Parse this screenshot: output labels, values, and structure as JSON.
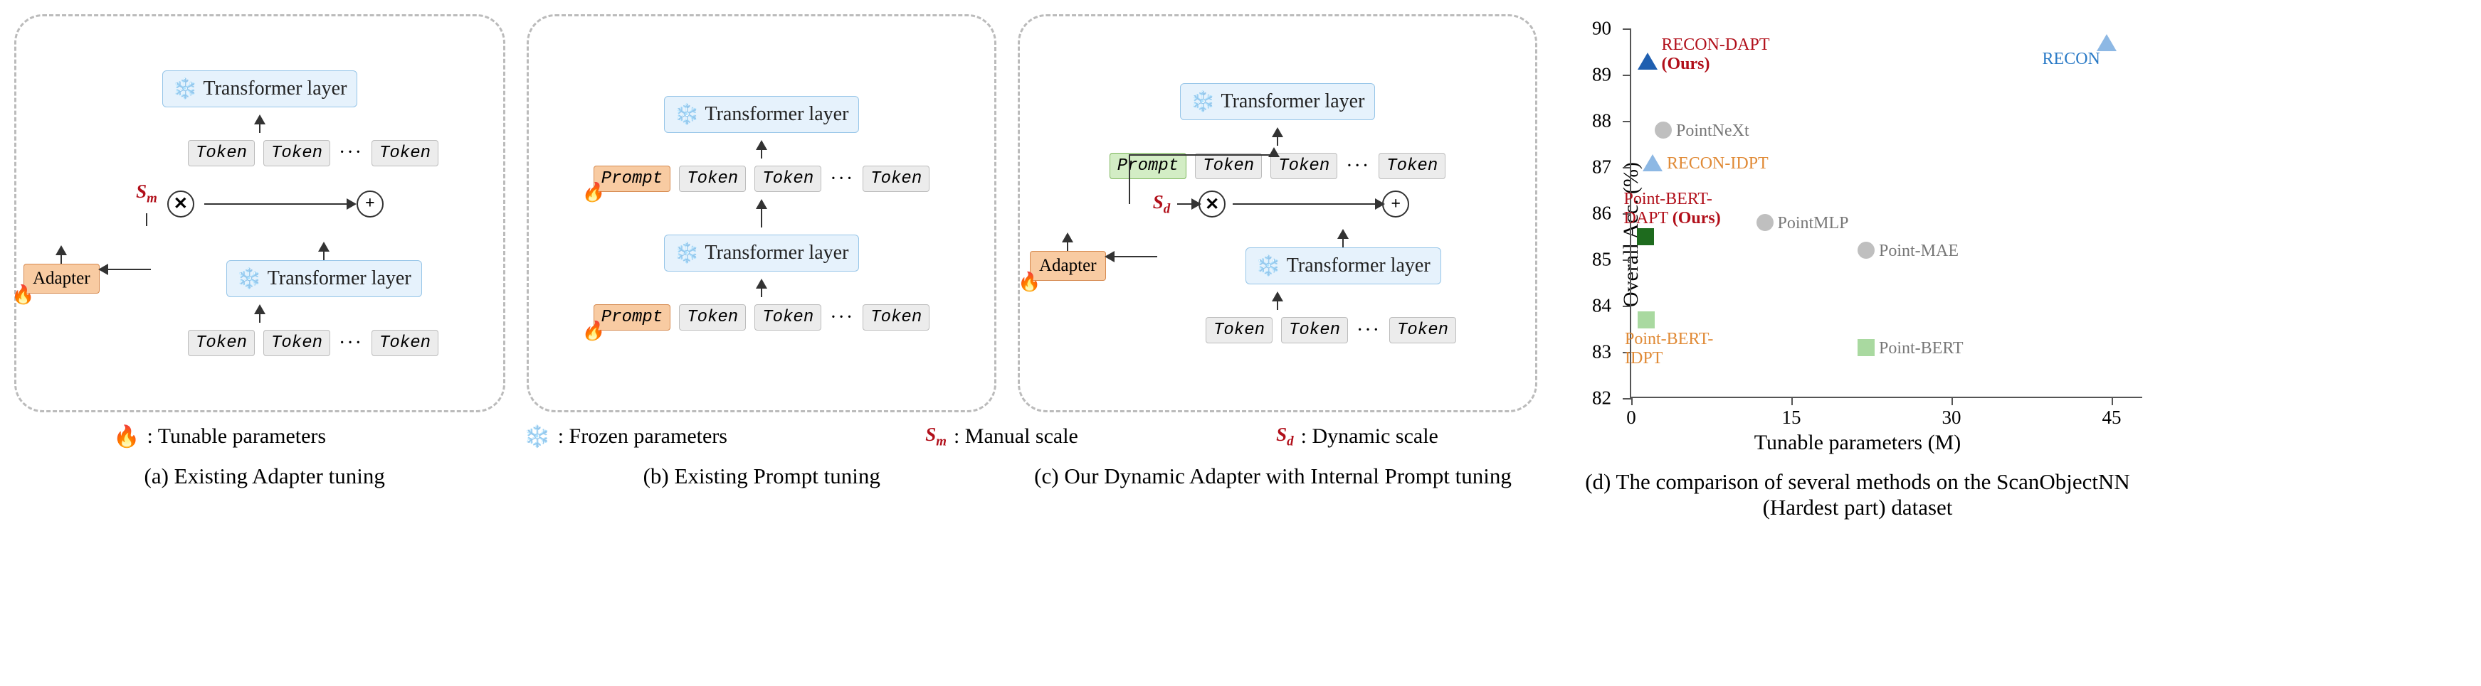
{
  "blocks": {
    "transformer": "Transformer layer",
    "token": "Token",
    "dots": "···",
    "prompt": "Prompt",
    "adapter": "Adapter"
  },
  "labels": {
    "sm": "S",
    "sm_sub": "m",
    "sd": "S",
    "sd_sub": "d"
  },
  "legend": {
    "fire": ": Tunable parameters",
    "snow": ": Frozen parameters",
    "sm": ": Manual scale",
    "sd": ": Dynamic scale"
  },
  "captions": {
    "a": "(a) Existing Adapter tuning",
    "b": "(b) Existing Prompt tuning",
    "c": "(c) Our Dynamic Adapter with Internal Prompt tuning",
    "d": "(d) The comparison of several methods on the ScanObjectNN (Hardest part) dataset"
  },
  "chart_data": {
    "type": "scatter",
    "xlabel": "Tunable parameters (M)",
    "ylabel": "Overall Acc. (%)",
    "xlim": [
      0,
      48
    ],
    "ylim": [
      82,
      90
    ],
    "xticks": [
      0,
      15,
      30,
      45
    ],
    "yticks": [
      82,
      83,
      84,
      85,
      86,
      87,
      88,
      89,
      90
    ],
    "series": [
      {
        "name": "RECON-DAPT (Ours)",
        "marker": "triangle",
        "color": "#1f5fb0",
        "x": 1.5,
        "y": 89.3,
        "label_color": "#b10f1a"
      },
      {
        "name": "RECON",
        "marker": "triangle",
        "color": "#8db8e4",
        "x": 44.5,
        "y": 89.7,
        "label_color": "#2a7ac6"
      },
      {
        "name": "RECON-IDPT",
        "marker": "triangle",
        "color": "#8db8e4",
        "x": 2.0,
        "y": 87.1,
        "label_color": "#e08a36"
      },
      {
        "name": "PointNeXt",
        "marker": "circle",
        "color": "#bfbfbf",
        "x": 3.0,
        "y": 87.8,
        "label_color": "#777"
      },
      {
        "name": "Point-BERT-DAPT (Ours)",
        "marker": "square",
        "color": "#1e6b1e",
        "x": 1.3,
        "y": 85.5,
        "label_color": "#b10f1a"
      },
      {
        "name": "PointMLP",
        "marker": "circle",
        "color": "#bfbfbf",
        "x": 12.5,
        "y": 85.8,
        "label_color": "#777"
      },
      {
        "name": "Point-MAE",
        "marker": "circle",
        "color": "#bfbfbf",
        "x": 22.0,
        "y": 85.2,
        "label_color": "#777"
      },
      {
        "name": "Point-BERT-IDPT",
        "marker": "square",
        "color": "#a9d9a0",
        "x": 1.4,
        "y": 83.7,
        "label_color": "#e08a36"
      },
      {
        "name": "Point-BERT",
        "marker": "square",
        "color": "#a9d9a0",
        "x": 22.0,
        "y": 83.1,
        "label_color": "#777"
      }
    ]
  }
}
